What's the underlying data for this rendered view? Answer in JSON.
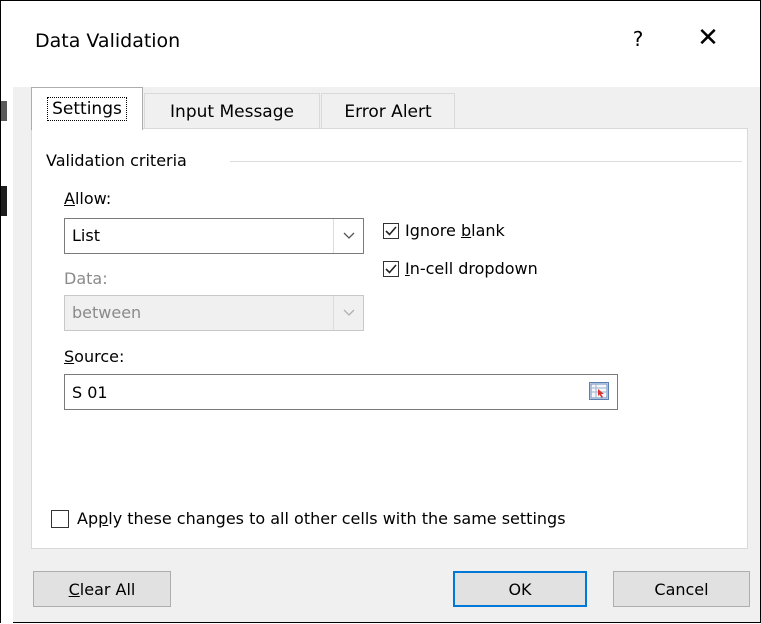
{
  "window": {
    "title": "Data Validation",
    "help_label": "?",
    "close_label": "✕"
  },
  "tabs": [
    {
      "label": "Settings",
      "active": true
    },
    {
      "label": "Input Message",
      "active": false
    },
    {
      "label": "Error Alert",
      "active": false
    }
  ],
  "criteria": {
    "group_label": "Validation criteria",
    "allow": {
      "label_key": "A",
      "label_rest": "llow:",
      "value": "List"
    },
    "data": {
      "label": "Data:",
      "value": "between"
    },
    "ignore_blank": {
      "pre": "Ignore ",
      "key": "b",
      "post": "lank",
      "checked": true
    },
    "in_cell_dropdown": {
      "key": "I",
      "post": "n-cell dropdown",
      "checked": true
    },
    "source": {
      "label_key": "S",
      "label_rest": "ource:",
      "value": "S 01"
    }
  },
  "apply_all": {
    "pre": "Ap",
    "key": "p",
    "post": "ly these changes to all other cells with the same settings",
    "checked": false
  },
  "buttons": {
    "clear_all": {
      "key": "C",
      "rest": "lear All"
    },
    "ok": "OK",
    "cancel": "Cancel"
  },
  "icons": [
    "chevron-down-icon",
    "checkbox-icon",
    "range-select-icon",
    "close-icon",
    "help-icon"
  ]
}
